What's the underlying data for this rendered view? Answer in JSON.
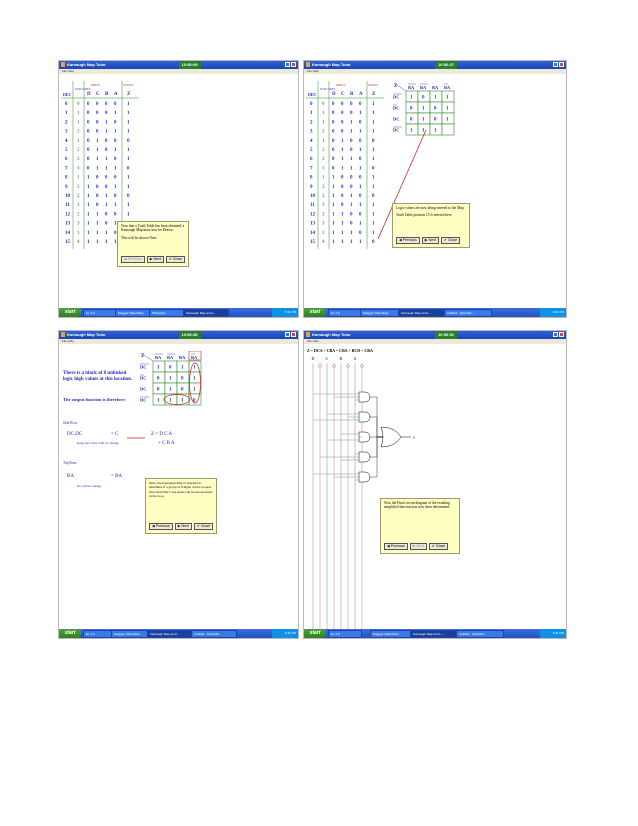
{
  "window": {
    "title": "Karnaugh Map Tutor",
    "menu": "File  Help",
    "clocks": [
      "10:56:09",
      "10:56:27",
      "10:56:38",
      "10:56:51"
    ]
  },
  "taskbar": {
    "start": "start",
    "s1": [
      "Ex 4.0",
      "Stagger Data Maze",
      "Whitestyle",
      "Karnaugh Map and L..."
    ],
    "s2": [
      "Ex 4.0",
      "Stagger Data Maze",
      "Karnaugh Map and L...",
      "Untitled - Scientific..."
    ],
    "s3": [
      "Ex 4.0",
      "Stagger Data Maze",
      "Karnaugh Map and L...",
      "Untitled - Scientific..."
    ],
    "s4": [
      "Ex 4.0",
      "Stagger Data Maze",
      "Karnaugh Map and L...",
      "Untitled - Scientific..."
    ],
    "time": "6:31 PM"
  },
  "truth_table": {
    "headers": {
      "dec": "DEC",
      "num": "NUM CODES",
      "inputs": "INPUTS",
      "output": "OUTPUT",
      "d": "D",
      "c": "C",
      "b": "B",
      "a": "A",
      "z": "Z"
    },
    "rows": [
      [
        "0",
        "0",
        "0",
        "0",
        "0",
        "0",
        "1"
      ],
      [
        "1",
        "1",
        "0",
        "0",
        "0",
        "1",
        "1"
      ],
      [
        "2",
        "1",
        "0",
        "0",
        "1",
        "0",
        "1"
      ],
      [
        "3",
        "2",
        "0",
        "0",
        "1",
        "1",
        "1"
      ],
      [
        "4",
        "1",
        "0",
        "1",
        "0",
        "0",
        "0"
      ],
      [
        "5",
        "2",
        "0",
        "1",
        "0",
        "1",
        "1"
      ],
      [
        "6",
        "2",
        "0",
        "1",
        "1",
        "0",
        "1"
      ],
      [
        "7",
        "3",
        "0",
        "1",
        "1",
        "1",
        "0"
      ],
      [
        "8",
        "1",
        "1",
        "0",
        "0",
        "0",
        "1"
      ],
      [
        "9",
        "2",
        "1",
        "0",
        "0",
        "1",
        "1"
      ],
      [
        "10",
        "2",
        "1",
        "0",
        "1",
        "0",
        "0"
      ],
      [
        "11",
        "3",
        "1",
        "0",
        "1",
        "1",
        "1"
      ],
      [
        "12",
        "2",
        "1",
        "1",
        "0",
        "0",
        "1"
      ],
      [
        "13",
        "3",
        "1",
        "1",
        "0",
        "1",
        "1"
      ],
      [
        "14",
        "3",
        "1",
        "1",
        "1",
        "0",
        "1"
      ],
      [
        "15",
        "4",
        "1",
        "1",
        "1",
        "1",
        "0"
      ]
    ]
  },
  "kmap": {
    "corner": "Z",
    "col_headers": [
      "BA",
      "BA",
      "BA",
      "BA"
    ],
    "row_headers": [
      "DC",
      "DC",
      "DC",
      "DC"
    ],
    "cells_partial": [
      [
        "1",
        "0",
        "1",
        "1"
      ],
      [
        "0",
        "1",
        "0",
        "1"
      ],
      [
        "0",
        "1",
        "0",
        "1"
      ],
      [
        "1",
        "1",
        "1",
        ""
      ]
    ],
    "cells_full": [
      [
        "1",
        "0",
        "1",
        "1"
      ],
      [
        "0",
        "1",
        "0",
        "1"
      ],
      [
        "0",
        "1",
        "0",
        "1"
      ],
      [
        "1",
        "1",
        "1",
        "0"
      ]
    ]
  },
  "s1_note": {
    "p1": "Now that a Truth Table has been obtained, a Karnaugh Map must now be Drawn.",
    "p2": "This will be shown Next."
  },
  "s2_note": {
    "p1": "Logic values are now being entered to the Map.",
    "p2": "Truth Table position 15 is entered here."
  },
  "s3": {
    "heading1": "There is a block of 8 unlinked logic high values at this location.",
    "heading2": "The output function is therefore:",
    "side_row": "Side Row:",
    "side_expr": "DC,DC",
    "side_result": "= C",
    "side_note": "Keep the value with no change",
    "top_row": "Top Row:",
    "top_expr": "BA",
    "top_result": "= BA",
    "top_note": "No values change",
    "result_z": "Z = D C A",
    "result_2": "+ C B A",
    "note": "Next, the Karnaugh Map is checked to determine if a group of 8 highs can be looped. Note that Don't care states can be incorporated in the loop."
  },
  "s4": {
    "equation": "Z = DCA + CBA + CBA + BCD + CBA",
    "inputs": [
      "D",
      "C",
      "B",
      "A"
    ],
    "output_label": "z",
    "note": "Now the Final circuit diagram of the resulting simplified function has now been determined."
  },
  "buttons": {
    "previous": "Previous",
    "next": "Next",
    "close": "Close"
  }
}
